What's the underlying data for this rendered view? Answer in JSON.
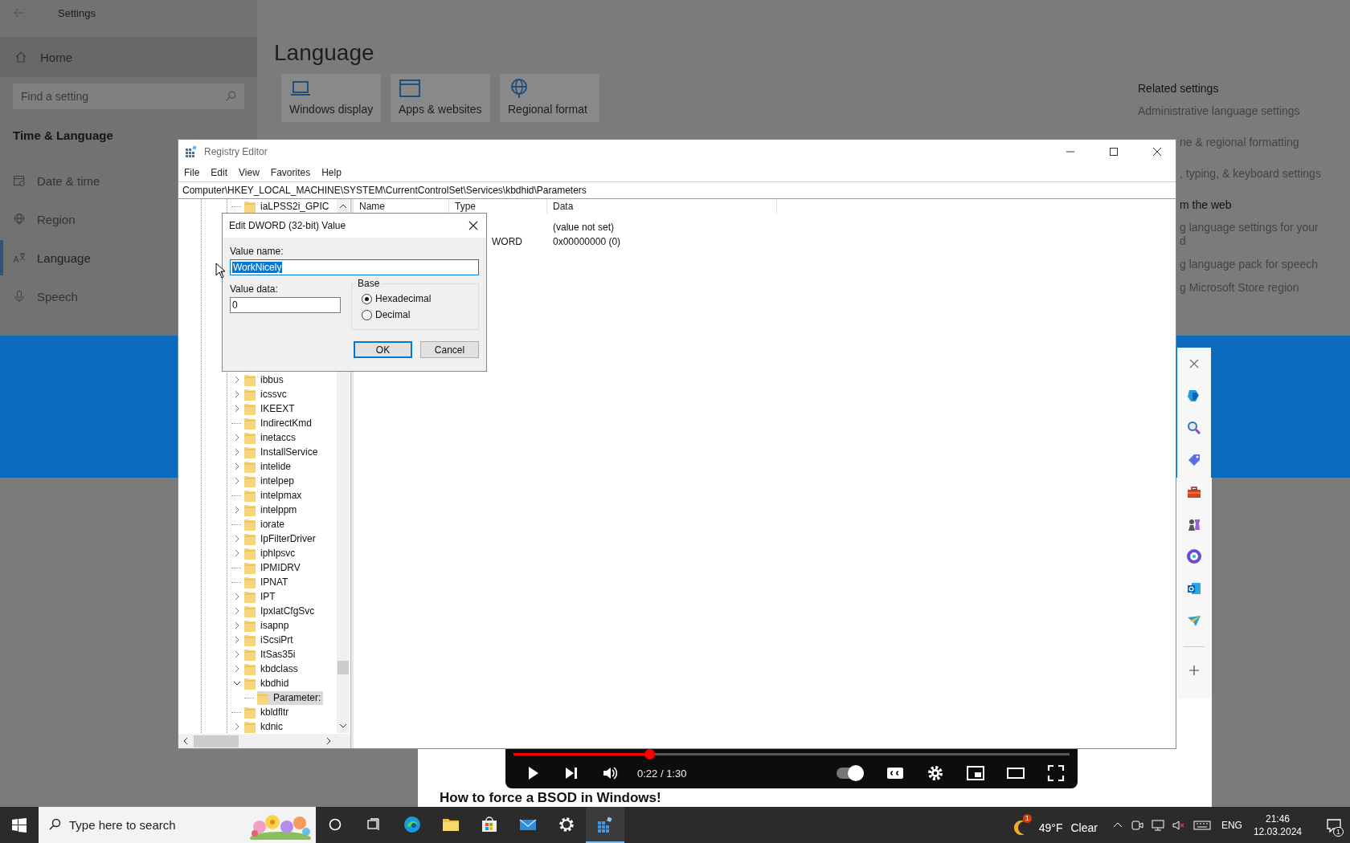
{
  "settings": {
    "title": "Settings",
    "home": "Home",
    "search": {
      "placeholder": "Find a setting"
    },
    "section": "Time & Language",
    "nav": [
      {
        "label": "Date & time",
        "kind": "calendar",
        "selected": false
      },
      {
        "label": "Region",
        "kind": "globe",
        "selected": false
      },
      {
        "label": "Language",
        "kind": "language",
        "selected": true
      },
      {
        "label": "Speech",
        "kind": "mic",
        "selected": false
      }
    ],
    "page_title": "Language",
    "tiles": [
      {
        "label": "Windows display",
        "kind": "laptop"
      },
      {
        "label": "Apps & websites",
        "kind": "window"
      },
      {
        "label": "Regional format",
        "kind": "globe"
      }
    ],
    "related": {
      "heading": "Related settings",
      "links": [
        "Administrative language settings"
      ]
    },
    "related_partial": [
      "ne & regional formatting",
      ", typing, & keyboard settings"
    ],
    "help": {
      "heading": "m the web",
      "links": [
        [
          "g language settings for your",
          "d"
        ],
        [
          "g language pack for speech"
        ],
        [
          "g Microsoft Store region"
        ]
      ]
    }
  },
  "registry": {
    "title": "Registry Editor",
    "menu": [
      "File",
      "Edit",
      "View",
      "Favorites",
      "Help"
    ],
    "address": "Computer\\HKEY_LOCAL_MACHINE\\SYSTEM\\CurrentControlSet\\Services\\kbdhid\\Parameters",
    "tree_top_rows": [
      {
        "name": "iaLPSS2i_GPIC",
        "kind": "leaf",
        "selected": false
      }
    ],
    "tree_rows": [
      {
        "name": "ibbus",
        "kind": "collapsed",
        "selected": false
      },
      {
        "name": "icssvc",
        "kind": "collapsed",
        "selected": false
      },
      {
        "name": "IKEEXT",
        "kind": "collapsed",
        "selected": false
      },
      {
        "name": "IndirectKmd",
        "kind": "leaf",
        "selected": false
      },
      {
        "name": "inetaccs",
        "kind": "collapsed",
        "selected": false
      },
      {
        "name": "InstallService",
        "kind": "collapsed",
        "selected": false
      },
      {
        "name": "intelide",
        "kind": "collapsed",
        "selected": false
      },
      {
        "name": "intelpep",
        "kind": "collapsed",
        "selected": false
      },
      {
        "name": "intelpmax",
        "kind": "leaf",
        "selected": false
      },
      {
        "name": "intelppm",
        "kind": "collapsed",
        "selected": false
      },
      {
        "name": "iorate",
        "kind": "leaf",
        "selected": false
      },
      {
        "name": "IpFilterDriver",
        "kind": "collapsed",
        "selected": false
      },
      {
        "name": "iphlpsvc",
        "kind": "collapsed",
        "selected": false
      },
      {
        "name": "IPMIDRV",
        "kind": "leaf",
        "selected": false
      },
      {
        "name": "IPNAT",
        "kind": "leaf",
        "selected": false
      },
      {
        "name": "IPT",
        "kind": "collapsed",
        "selected": false
      },
      {
        "name": "IpxlatCfgSvc",
        "kind": "collapsed",
        "selected": false
      },
      {
        "name": "isapnp",
        "kind": "collapsed",
        "selected": false
      },
      {
        "name": "iScsiPrt",
        "kind": "collapsed",
        "selected": false
      },
      {
        "name": "ItSas35i",
        "kind": "collapsed",
        "selected": false
      },
      {
        "name": "kbdclass",
        "kind": "collapsed",
        "selected": false
      },
      {
        "name": "kbdhid",
        "kind": "expanded",
        "selected": false,
        "children": [
          {
            "name": "Parameter:",
            "kind": "leaf",
            "selected": true
          }
        ]
      },
      {
        "name": "kbldfltr",
        "kind": "leaf",
        "selected": false
      },
      {
        "name": "kdnic",
        "kind": "collapsed",
        "selected": false
      }
    ],
    "columns": [
      "Name",
      "Type",
      "Data"
    ],
    "rows": [
      {
        "data": "(value not set)"
      },
      {
        "type": "WORD",
        "data": "0x00000000 (0)"
      }
    ]
  },
  "dialog": {
    "title": "Edit DWORD (32-bit) Value",
    "name_label": "Value name:",
    "name_field": {
      "value": "WorkNicely",
      "selected": true
    },
    "data_label": "Value data:",
    "data_field": {
      "value": "0"
    },
    "base_label": "Base",
    "bases": [
      {
        "label": "Hexadecimal",
        "selected": true
      },
      {
        "label": "Decimal",
        "selected": false
      }
    ],
    "buttons": [
      {
        "label": "OK",
        "default": true
      },
      {
        "label": "Cancel",
        "default": false
      }
    ]
  },
  "video": {
    "time": "0:22 / 1:30",
    "level": 0.244,
    "autoplay": true,
    "title": "How to force a BSOD in Windows!"
  },
  "taskbar": {
    "search": {
      "placeholder": "Type here to search"
    },
    "apps": [
      {
        "kind": "circle",
        "active": false
      },
      {
        "kind": "taskview",
        "active": false
      },
      {
        "kind": "browser",
        "active": false
      },
      {
        "kind": "folder",
        "active": false
      },
      {
        "kind": "store",
        "active": false
      },
      {
        "kind": "mail",
        "active": false
      },
      {
        "kind": "gear",
        "active": false
      },
      {
        "kind": "registry",
        "active": true
      }
    ],
    "weather": {
      "badge": "1",
      "temp": "49°F",
      "condition": "Clear"
    },
    "language": "ENG",
    "time": "21:46",
    "date": "12.03.2024",
    "notifications": "1"
  }
}
